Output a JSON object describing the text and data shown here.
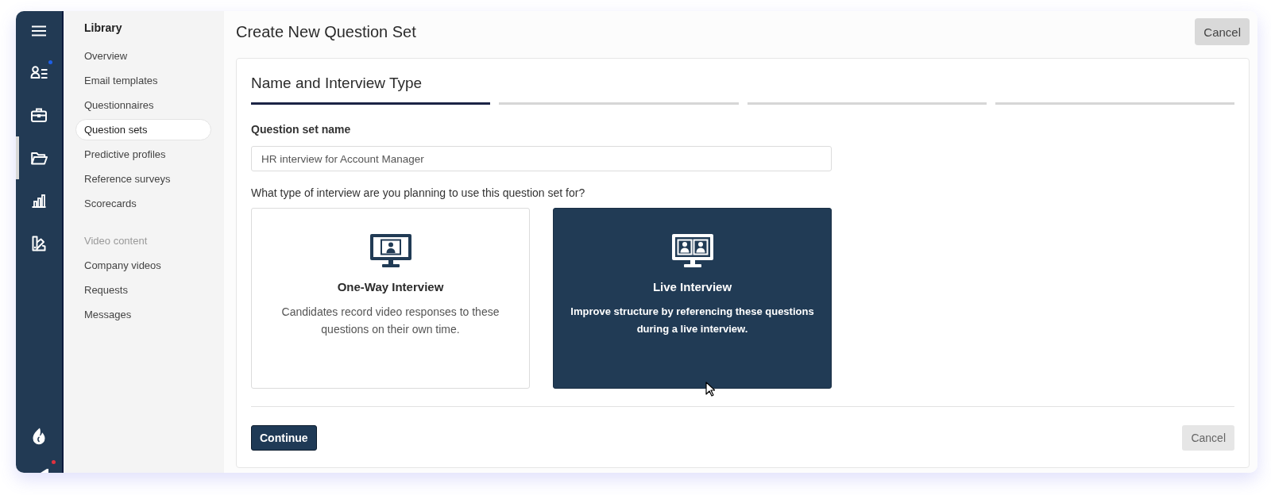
{
  "rail": {
    "items": [
      {
        "kind": "people",
        "selected": false,
        "color": "#1e5fe6"
      },
      {
        "kind": "briefcase",
        "selected": false
      },
      {
        "kind": "folder",
        "selected": true
      },
      {
        "kind": "chart",
        "selected": false
      },
      {
        "kind": "swatch",
        "selected": false
      }
    ],
    "bottom_items": [
      {
        "kind": "flame"
      },
      {
        "kind": "partial",
        "color": "#e0323f"
      }
    ]
  },
  "sidebar": {
    "title": "Library",
    "sections": [
      {
        "items": [
          {
            "label": "Overview",
            "selected": false
          },
          {
            "label": "Email templates",
            "selected": false
          },
          {
            "label": "Questionnaires",
            "selected": false
          },
          {
            "label": "Question sets",
            "selected": true
          },
          {
            "label": "Predictive profiles",
            "selected": false
          },
          {
            "label": "Reference surveys",
            "selected": false
          },
          {
            "label": "Scorecards",
            "selected": false
          }
        ]
      },
      {
        "heading": "Video content",
        "items": [
          {
            "label": "Company videos",
            "selected": false
          },
          {
            "label": "Requests",
            "selected": false
          },
          {
            "label": "Messages",
            "selected": false
          }
        ]
      }
    ]
  },
  "page": {
    "title": "Create New Question Set",
    "cancel": "Cancel"
  },
  "form": {
    "step_title": "Name and Interview Type",
    "steps": [
      {
        "selected": true
      },
      {
        "selected": false
      },
      {
        "selected": false
      },
      {
        "selected": false
      }
    ],
    "name_label": "Question set name",
    "name_value": "HR interview for Account Manager",
    "type_question": "What type of interview are you planning to use this question set for?",
    "options": [
      {
        "kind": "one-way",
        "title": "One-Way Interview",
        "description": "Candidates record video responses to these questions on their own time.",
        "selected": false
      },
      {
        "kind": "live",
        "title": "Live Interview",
        "description": "Improve structure by referencing these questions during a live interview.",
        "selected": true
      }
    ],
    "continue": "Continue",
    "cancel": "Cancel"
  }
}
